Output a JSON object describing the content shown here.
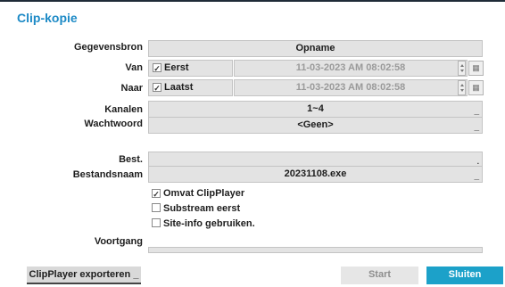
{
  "dialog": {
    "title": "Clip-kopie"
  },
  "source": {
    "label": "Gegevensbron",
    "value": "Opname"
  },
  "from": {
    "label": "Van",
    "checkbox_label": "Eerst",
    "checked": true,
    "datetime": "11-03-2023  AM 08:02:58"
  },
  "to": {
    "label": "Naar",
    "checkbox_label": "Laatst",
    "checked": true,
    "datetime": "11-03-2023  AM 08:02:58"
  },
  "channels": {
    "label": "Kanalen",
    "value": "1~4"
  },
  "password": {
    "label": "Wachtwoord",
    "value": "<Geen>"
  },
  "destination": {
    "label": "Best.",
    "value": ""
  },
  "filename": {
    "label": "Bestandsnaam",
    "value": "20231108.exe"
  },
  "options": [
    {
      "label": "Omvat ClipPlayer",
      "checked": true
    },
    {
      "label": "Substream eerst",
      "checked": false
    },
    {
      "label": "Site-info gebruiken.",
      "checked": false
    }
  ],
  "progress": {
    "label": "Voortgang",
    "fraction": 0
  },
  "buttons": {
    "export": "ClipPlayer exporteren",
    "start": "Start",
    "close": "Sluiten"
  },
  "colors": {
    "accent": "#1d8ac6",
    "close_button": "#1ca1c9",
    "start_button": "#e6e6e6",
    "export_button": "#d9d9d9"
  },
  "icons": {
    "check": "checkmark-icon",
    "calendar": "calendar-icon",
    "spinner": "spinner-arrows-icon"
  }
}
